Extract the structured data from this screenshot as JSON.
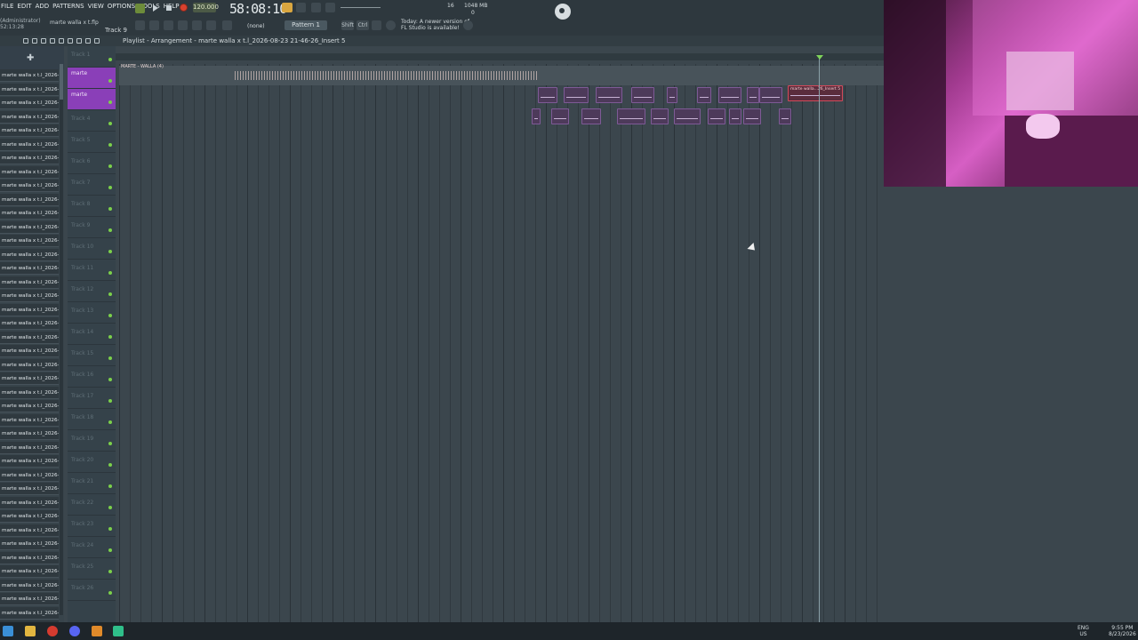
{
  "app": {
    "menu": [
      "FILE",
      "EDIT",
      "ADD",
      "PATTERNS",
      "VIEW",
      "OPTIONS",
      "TOOLS",
      "HELP"
    ],
    "hint_line1": "(Administrator)",
    "hint_line2": "52:13:28",
    "file_name": "marte walla x t.flp",
    "track_hint": "Track 9",
    "bpm": "120.000",
    "time": "58:08:10",
    "cpu": "16",
    "memory": "1048 MB",
    "memory2": "0",
    "snap": "(none)",
    "pattern": "Pattern 1",
    "shift": "Shift",
    "ctrl": "Ctrl",
    "notice_line1": "Today: A newer version of",
    "notice_line2": "FL Studio is available!"
  },
  "playlist": {
    "title": "Playlist - Arrangement",
    "breadcrumb": "marte walla x t.l_2026-08-23 21-46-26_Insert 5",
    "audio_track_label": "MARTE - WALLA (4)",
    "red_clip_label": "marte walla...26_Insert 5"
  },
  "browser_items": [
    "marte walla x t.l_2026-0...",
    "marte walla x t.l_2026-0...",
    "marte walla x t.l_2026-0...",
    "marte walla x t.l_2026-8",
    "marte walla x t.l_2026-0...",
    "marte walla x t.l_2026-8",
    "marte walla x t.l_2026-0...",
    "marte walla x t.l_2026-0...",
    "marte walla x t.l_2026-8",
    "marte walla x t.l_2026-0...",
    "marte walla x t.l_2026-0...",
    "marte walla x t.l_2026-8",
    "marte walla x t.l_2026-0...",
    "marte walla x t.l_2026-0...",
    "marte walla x t.l_2026-8",
    "marte walla x t.l_2026-0...",
    "marte walla x t.l_2026-0...",
    "marte walla x t.l_2026-8",
    "marte walla x t.l_2026-0...",
    "marte walla x t.l_2026-0...",
    "marte walla x t.l_2026-8",
    "marte walla x t.l_2026-0...",
    "marte walla x t.l_2026-0...",
    "marte walla x t.l_2026-8",
    "marte walla x t.l_2026-0...",
    "marte walla x t.l_2026-0...",
    "marte walla x t.l_2026-8",
    "marte walla x t.l_2026-0...",
    "marte walla x t.l_2026-0...",
    "marte walla x t.l_2026-8",
    "marte walla x t.l_2026-0...",
    "marte walla x t.l_2026-0...",
    "marte walla x t.l_2026-8",
    "marte walla x t.l_2026-0...",
    "marte walla x t.l_2026-0...",
    "marte walla x t.l_2026-8",
    "marte walla x t.l_2026-0...",
    "marte walla x t.l_2026-0...",
    "marte walla x t.l_2026-8",
    "marte walla x t.l_2026-0...",
    "marte walla x t.l_2026-0..."
  ],
  "tracks": [
    "Track 1",
    "marte",
    "marte",
    "Track 4",
    "Track 5",
    "Track 6",
    "Track 7",
    "Track 8",
    "Track 9",
    "Track 10",
    "Track 11",
    "Track 12",
    "Track 13",
    "Track 14",
    "Track 15",
    "Track 16",
    "Track 17",
    "Track 18",
    "Track 19",
    "Track 20",
    "Track 21",
    "Track 22",
    "Track 23",
    "Track 24",
    "Track 25",
    "Track 26"
  ],
  "taskbar": {
    "lang": "ENG",
    "region": "US",
    "clock_time": "9:55 PM",
    "clock_date": "8/23/2026"
  }
}
